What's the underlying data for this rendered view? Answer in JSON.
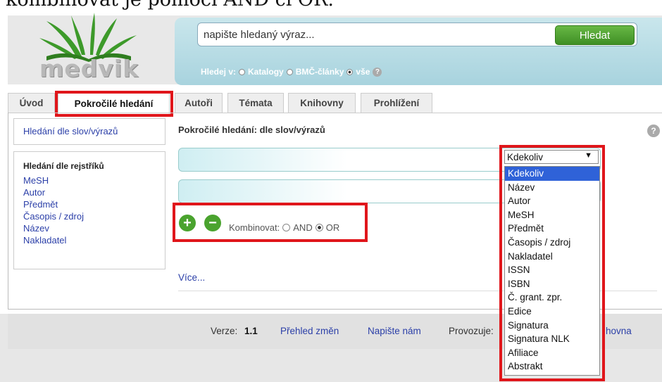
{
  "caption": "kombinovat je pomocí AND či OR.",
  "logo": {
    "text": "medvik"
  },
  "search": {
    "placeholder": "napište hledaný výraz...",
    "button": "Hledat",
    "in_label": "Hledej v:",
    "options": [
      "Katalogy",
      "BMČ-články",
      "vše"
    ],
    "selected": "vše",
    "help": "?"
  },
  "tabs": [
    "Úvod",
    "Pokročilé hledání",
    "Autoři",
    "Témata",
    "Knihovny",
    "Prohlížení"
  ],
  "active_tab": "Pokročilé hledání",
  "sidebar": {
    "top_link": "Hledání dle slov/výrazů",
    "index_heading": "Hledání dle rejstříků",
    "index_links": [
      "MeSH",
      "Autor",
      "Předmět",
      "Časopis / zdroj",
      "Název",
      "Nakladatel"
    ]
  },
  "content": {
    "title": "Pokročilé hledání: dle slov/výrazů",
    "help": "?",
    "add": "+",
    "remove": "−",
    "combine_label": "Kombinovat:",
    "combine_options": [
      "AND",
      "OR"
    ],
    "combine_selected": "OR",
    "more": "Více..."
  },
  "field_select": {
    "value": "Kdekoliv",
    "arrow": "▼",
    "options": [
      "Kdekoliv",
      "Název",
      "Autor",
      "MeSH",
      "Předmět",
      "Časopis / zdroj",
      "Nakladatel",
      "ISSN",
      "ISBN",
      "Č. grant. zpr.",
      "Edice",
      "Signatura",
      "Signatura NLK",
      "Afiliace",
      "Abstrakt"
    ],
    "highlighted": "Kdekoliv"
  },
  "footer": {
    "version_label": "Verze:",
    "version": "1.1",
    "changes": "Přehled změn",
    "contact": "Napište nám",
    "operator_label": "Provozuje:",
    "operator_tail": "hovna"
  },
  "colors": {
    "highlight": "#e0161b",
    "accent": "#4aa32e",
    "link": "#2b3fa8",
    "selected_option": "#2f62d8"
  }
}
